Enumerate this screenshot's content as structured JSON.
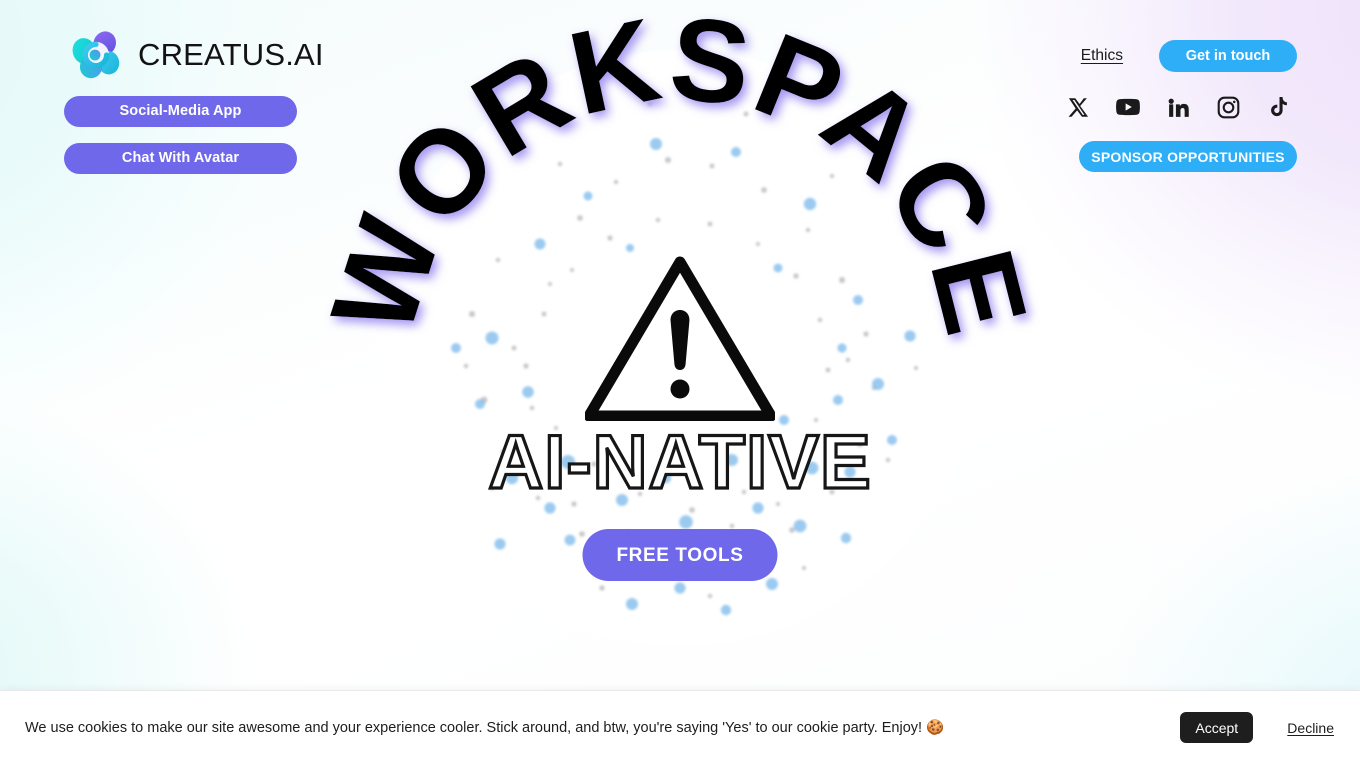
{
  "brand": {
    "name": "CREATUS.AI",
    "logo_icon": "creatus-petal-logo",
    "colors": {
      "purple": "#6F68EA",
      "blue": "#2EAEF7",
      "teal": "#19D3D3",
      "violet": "#7B5CE8",
      "dark": "#1E1E1E"
    }
  },
  "sidebar": {
    "buttons": [
      {
        "label": "Social-Media App",
        "name": "social-media-app-button"
      },
      {
        "label": "Chat With Avatar",
        "name": "chat-with-avatar-button"
      }
    ]
  },
  "nav": {
    "ethics_label": "Ethics",
    "get_in_touch_label": "Get in touch",
    "sponsor_label": "SPONSOR OPPORTUNITIES",
    "social": [
      {
        "name": "x-twitter-icon",
        "label": "X"
      },
      {
        "name": "youtube-icon",
        "label": "YouTube"
      },
      {
        "name": "linkedin-icon",
        "label": "LinkedIn"
      },
      {
        "name": "instagram-icon",
        "label": "Instagram"
      },
      {
        "name": "tiktok-icon",
        "label": "TikTok"
      }
    ]
  },
  "hero": {
    "arc_word": "WORKSPACE",
    "outline_word": "AI-NATIVE",
    "warning_icon": "warning-triangle-icon",
    "cta_label": "FREE TOOLS"
  },
  "cookie": {
    "message": "We use cookies to make our site awesome and your experience cooler. Stick around, and btw, you're saying 'Yes' to our cookie party. Enjoy! 🍪",
    "accept_label": "Accept",
    "decline_label": "Decline"
  }
}
